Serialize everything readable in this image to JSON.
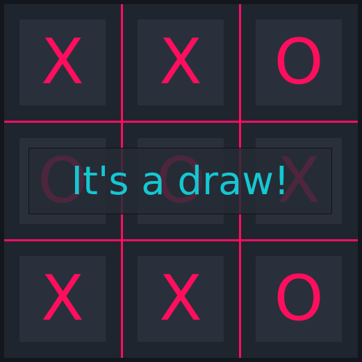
{
  "game": {
    "board": [
      [
        "X",
        "X",
        "O"
      ],
      [
        "O",
        "O",
        "X"
      ],
      [
        "X",
        "X",
        "O"
      ]
    ],
    "result_message": "It's a draw!"
  },
  "colors": {
    "mark": "#ff0e5e",
    "grid_line": "#ff0e5e",
    "message": "#14c8d2",
    "cell_background": "#29303b",
    "board_background": "#1f252e"
  }
}
